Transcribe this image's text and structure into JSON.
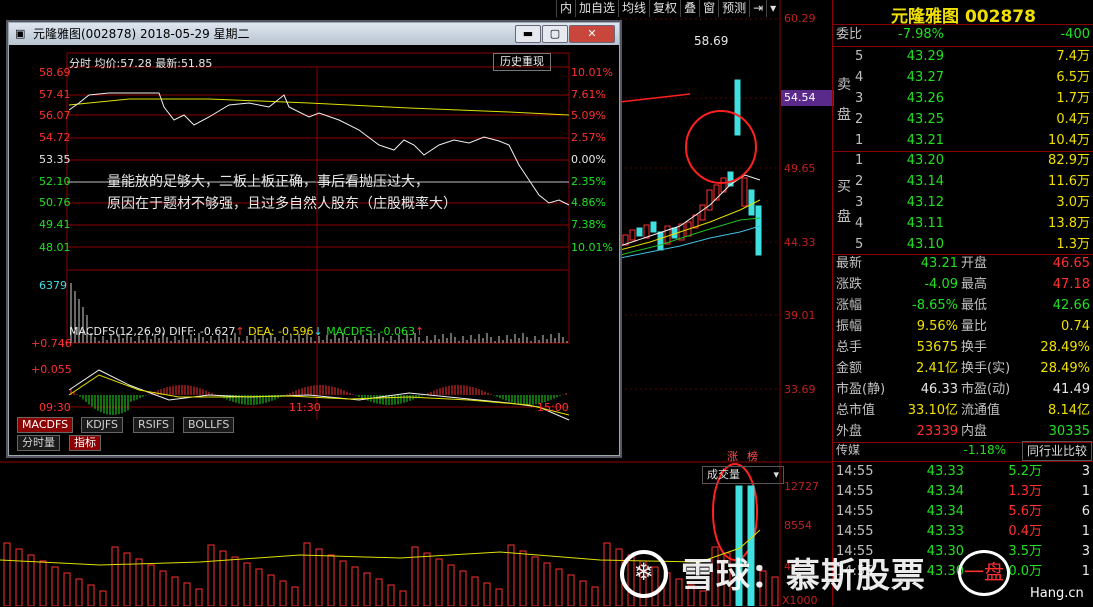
{
  "toolbar": {
    "items": [
      "内",
      "加自选",
      "均线",
      "复权",
      "叠",
      "窗",
      "预测"
    ]
  },
  "main_axis": {
    "labels": [
      "60.29",
      "54.54",
      "49.65",
      "44.33",
      "39.01",
      "33.69"
    ],
    "current_tag": "54.54"
  },
  "high_marker": "58.69",
  "volume_panel": {
    "tabs": [
      "涨",
      "榜"
    ],
    "selector": "成交量",
    "axis": [
      "12727",
      "8554",
      "42",
      "X1000"
    ]
  },
  "quote": {
    "title": "元隆雅图 002878",
    "weibi": {
      "label": "委比",
      "pct": "-7.98%",
      "diff": "-400"
    },
    "sell": [
      {
        "level": "5",
        "price": "43.29",
        "vol": "7.4万"
      },
      {
        "level": "4",
        "price": "43.27",
        "vol": "6.5万"
      },
      {
        "level": "3",
        "price": "43.26",
        "vol": "1.7万"
      },
      {
        "level": "2",
        "price": "43.25",
        "vol": "0.4万"
      },
      {
        "level": "1",
        "price": "43.21",
        "vol": "10.4万"
      }
    ],
    "sell_label": [
      "卖",
      "盘"
    ],
    "buy": [
      {
        "level": "1",
        "price": "43.20",
        "vol": "82.9万"
      },
      {
        "level": "2",
        "price": "43.14",
        "vol": "11.6万"
      },
      {
        "level": "3",
        "price": "43.12",
        "vol": "3.0万"
      },
      {
        "level": "4",
        "price": "43.11",
        "vol": "13.8万"
      },
      {
        "level": "5",
        "price": "43.10",
        "vol": "1.3万"
      }
    ],
    "buy_label": [
      "买",
      "盘"
    ],
    "stats": [
      {
        "l1": "最新",
        "v1": "43.21",
        "c1": "green",
        "l2": "开盘",
        "v2": "46.65",
        "c2": "red"
      },
      {
        "l1": "涨跌",
        "v1": "-4.09",
        "c1": "green",
        "l2": "最高",
        "v2": "47.18",
        "c2": "red"
      },
      {
        "l1": "涨幅",
        "v1": "-8.65%",
        "c1": "green",
        "l2": "最低",
        "v2": "42.66",
        "c2": "green"
      },
      {
        "l1": "振幅",
        "v1": "9.56%",
        "c1": "yellow",
        "l2": "量比",
        "v2": "0.74",
        "c2": "yellow"
      },
      {
        "l1": "总手",
        "v1": "53675",
        "c1": "yellow",
        "l2": "换手",
        "v2": "28.49%",
        "c2": "yellow"
      },
      {
        "l1": "金额",
        "v1": "2.41亿",
        "c1": "yellow",
        "l2": "换手(实)",
        "v2": "28.49%",
        "c2": "yellow"
      },
      {
        "l1": "市盈(静)",
        "v1": "46.33",
        "c1": "white",
        "l2": "市盈(动)",
        "v2": "41.49",
        "c2": "white"
      },
      {
        "l1": "总市值",
        "v1": "33.10亿",
        "c1": "yellow",
        "l2": "流通值",
        "v2": "8.14亿",
        "c2": "yellow"
      },
      {
        "l1": "外盘",
        "v1": "23339",
        "c1": "red",
        "l2": "内盘",
        "v2": "30335",
        "c2": "green"
      }
    ],
    "industry": {
      "name": "传媒",
      "pct": "-1.18%",
      "compare_btn": "同行业比较"
    },
    "ticks": [
      {
        "time": "14:55",
        "price": "43.33",
        "vol": "5.2万",
        "n": "3",
        "c": "green"
      },
      {
        "time": "14:55",
        "price": "43.34",
        "vol": "1.3万",
        "n": "1",
        "c": "red"
      },
      {
        "time": "14:55",
        "price": "43.34",
        "vol": "5.6万",
        "n": "6",
        "c": "red"
      },
      {
        "time": "14:55",
        "price": "43.33",
        "vol": "0.4万",
        "n": "1",
        "c": "red"
      },
      {
        "time": "14:55",
        "price": "43.30",
        "vol": "3.5万",
        "n": "3",
        "c": "green"
      },
      {
        "time": "14:55",
        "price": "43.30",
        "vol": "0.0万",
        "n": "1",
        "c": "green"
      }
    ]
  },
  "popup": {
    "title": "元隆雅图(002878) 2018-05-29 星期二",
    "header": {
      "label": "分时",
      "avg_label": "均价:",
      "avg": "57.28",
      "last_label": "最新:",
      "last": "51.85",
      "replay": "历史重现"
    },
    "left_axis": [
      "58.69",
      "57.41",
      "56.07",
      "54.72",
      "53.35",
      "52.10",
      "50.76",
      "49.41",
      "48.01"
    ],
    "right_axis": [
      "10.01%",
      "7.61%",
      "5.09%",
      "2.57%",
      "0.00%",
      "2.35%",
      "4.86%",
      "7.38%",
      "10.01%"
    ],
    "vol_label": "6379",
    "macd_header": {
      "name": "MACDFS(12,26,9)",
      "diff": "DIFF: -0.627",
      "dea": "DEA: -0.596",
      "macd": "MACDFS: -0.063"
    },
    "macd_axis": [
      "+0.746",
      "+0.055"
    ],
    "time_axis": [
      "09:30",
      "11:30",
      "15:00"
    ],
    "indicator_tabs": [
      "MACDFS",
      "KDJFS",
      "RSIFS",
      "BOLLFS"
    ],
    "bottom_tabs": [
      "分时量",
      "指标"
    ],
    "annotation": [
      "量能放的足够大，二板上板正确，事后看抛压过大，",
      "原因在于题材不够强，且过多自然人股东（庄股概率大）"
    ]
  },
  "watermark": {
    "text": "雪球：慕斯股票",
    "badge": "一盘",
    "site": "Hang.cn"
  }
}
